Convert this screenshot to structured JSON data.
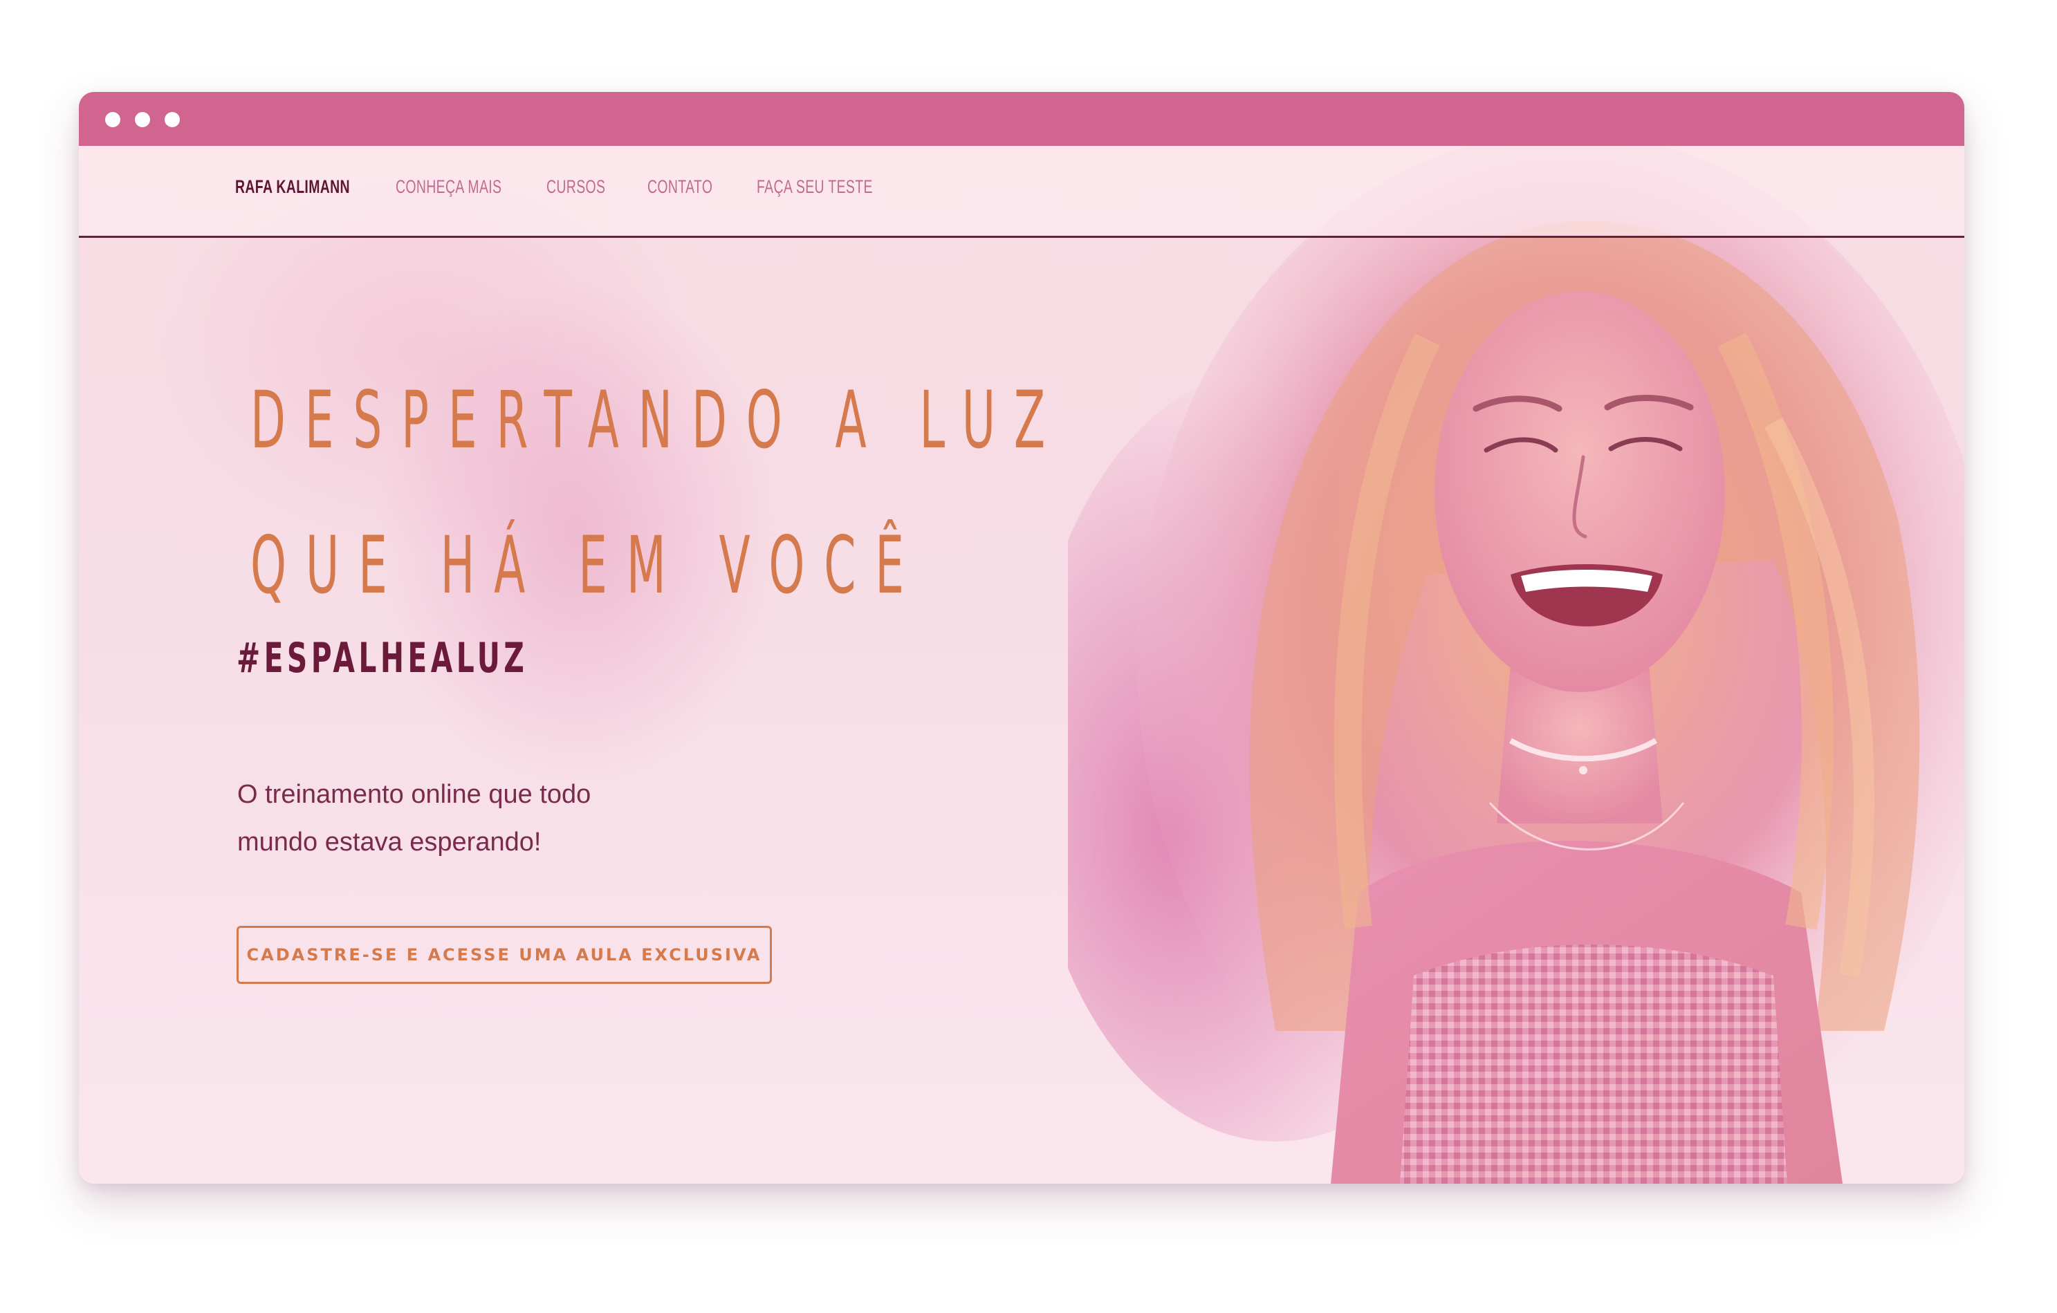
{
  "window": {
    "controls": [
      "dot",
      "dot",
      "dot"
    ]
  },
  "nav": {
    "brand": "RAFA KALIMANN",
    "items": [
      {
        "label": "CONHEÇA MAIS"
      },
      {
        "label": "CURSOS"
      },
      {
        "label": "CONTATO"
      },
      {
        "label": "FAÇA SEU TESTE"
      }
    ]
  },
  "hero": {
    "headline_line1": "DESPERTANDO A LUZ",
    "headline_line2": "QUE HÁ EM VOCÊ",
    "hashtag": "#ESPALHEALUZ",
    "subtitle_line1": "O treinamento online que todo",
    "subtitle_line2": "mundo estava esperando!",
    "cta_label": "CADASTRE-SE E ACESSE UMA AULA EXCLUSIVA"
  },
  "colors": {
    "titlebar": "#d0668f",
    "headline": "#d57a4c",
    "brand_text": "#5c1532",
    "nav_text": "#c06a8e",
    "hashtag": "#6b1a3a",
    "cta_border": "#d57a4c"
  }
}
